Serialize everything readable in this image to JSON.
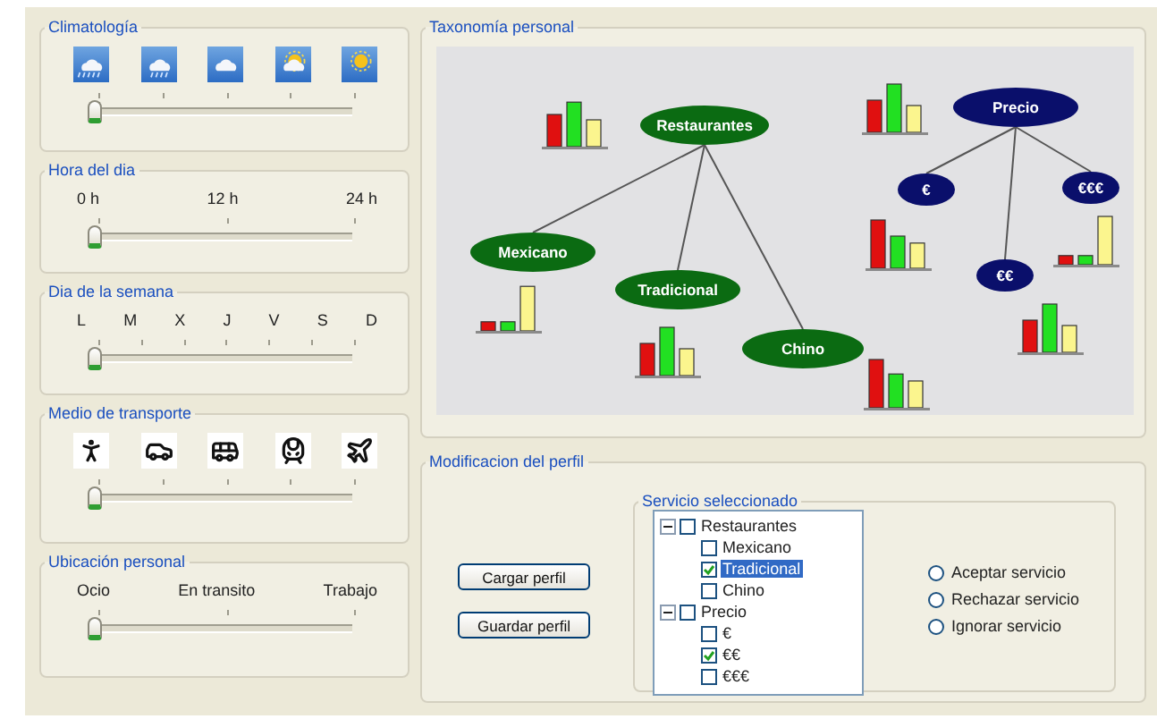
{
  "controls": [
    {
      "kind": "weather",
      "title": "Climatología",
      "slider": {
        "level": 0
      }
    },
    {
      "kind": "labels",
      "title": "Hora del dia",
      "labels": [
        "0 h",
        "12 h",
        "24 h"
      ],
      "slider": {
        "level": 0
      }
    },
    {
      "kind": "labels",
      "title": "Dia de la semana",
      "labels": [
        "L",
        "M",
        "X",
        "J",
        "V",
        "S",
        "D"
      ],
      "slider": {
        "level": 0
      }
    },
    {
      "kind": "transport",
      "title": "Medio de transporte",
      "slider": {
        "level": 0
      }
    },
    {
      "kind": "labels",
      "title": "Ubicación personal",
      "labels": [
        "Ocio",
        "En transito",
        "Trabajo"
      ],
      "slider": {
        "level": 0
      }
    }
  ],
  "taxonomy": {
    "title": "Taxonomía personal",
    "nodes": [
      {
        "label": "Restaurantes",
        "color": "#0b6b12",
        "bars": [
          {
            "level": 0.6
          },
          {
            "level": 0.83
          },
          {
            "level": 0.5
          }
        ],
        "children": [
          {
            "label": "Mexicano",
            "color": "#0b6b12",
            "bars": [
              {
                "level": 0.17
              },
              {
                "level": 0.17
              },
              {
                "level": 0.83
              }
            ]
          },
          {
            "label": "Tradicional",
            "color": "#0b6b12",
            "bars": [
              {
                "level": 0.6
              },
              {
                "level": 0.9
              },
              {
                "level": 0.5
              }
            ]
          },
          {
            "label": "Chino",
            "color": "#0b6b12",
            "bars": [
              {
                "level": 0.9
              },
              {
                "level": 0.63
              },
              {
                "level": 0.5
              }
            ]
          }
        ]
      },
      {
        "label": "Precio",
        "color": "#0a0f6b",
        "bars": [
          {
            "level": 0.6
          },
          {
            "level": 0.9
          },
          {
            "level": 0.5
          }
        ],
        "children": [
          {
            "label": "€",
            "color": "#0a0f6b",
            "bars": [
              {
                "level": 0.9
              },
              {
                "level": 0.6
              },
              {
                "level": 0.47
              }
            ]
          },
          {
            "label": "€€",
            "color": "#0a0f6b",
            "bars": [
              {
                "level": 0.6
              },
              {
                "level": 0.9
              },
              {
                "level": 0.5
              }
            ]
          },
          {
            "label": "€€€",
            "color": "#0a0f6b",
            "bars": [
              {
                "level": 0.17
              },
              {
                "level": 0.17
              },
              {
                "level": 0.9
              }
            ]
          }
        ]
      }
    ]
  },
  "profile": {
    "title": "Modificacion del perfil",
    "buttons": [
      "Cargar perfil",
      "Guardar perfil"
    ],
    "service": {
      "title": "Servicio seleccionado",
      "tree": [
        {
          "label": "Restaurantes",
          "checked": false,
          "selected": false,
          "expanded": true,
          "children": [
            {
              "label": "Mexicano",
              "checked": false,
              "selected": false
            },
            {
              "label": "Tradicional",
              "checked": true,
              "selected": true
            },
            {
              "label": "Chino",
              "checked": false,
              "selected": false
            }
          ]
        },
        {
          "label": "Precio",
          "checked": false,
          "selected": false,
          "expanded": true,
          "children": [
            {
              "label": "€",
              "checked": false,
              "selected": false
            },
            {
              "label": "€€",
              "checked": true,
              "selected": false
            },
            {
              "label": "€€€",
              "checked": false,
              "selected": false
            }
          ]
        }
      ],
      "options": [
        {
          "label": "Aceptar servicio",
          "selected": false
        },
        {
          "label": "Rechazar servicio",
          "selected": false
        },
        {
          "label": "Ignorar servicio",
          "selected": false
        }
      ]
    }
  }
}
